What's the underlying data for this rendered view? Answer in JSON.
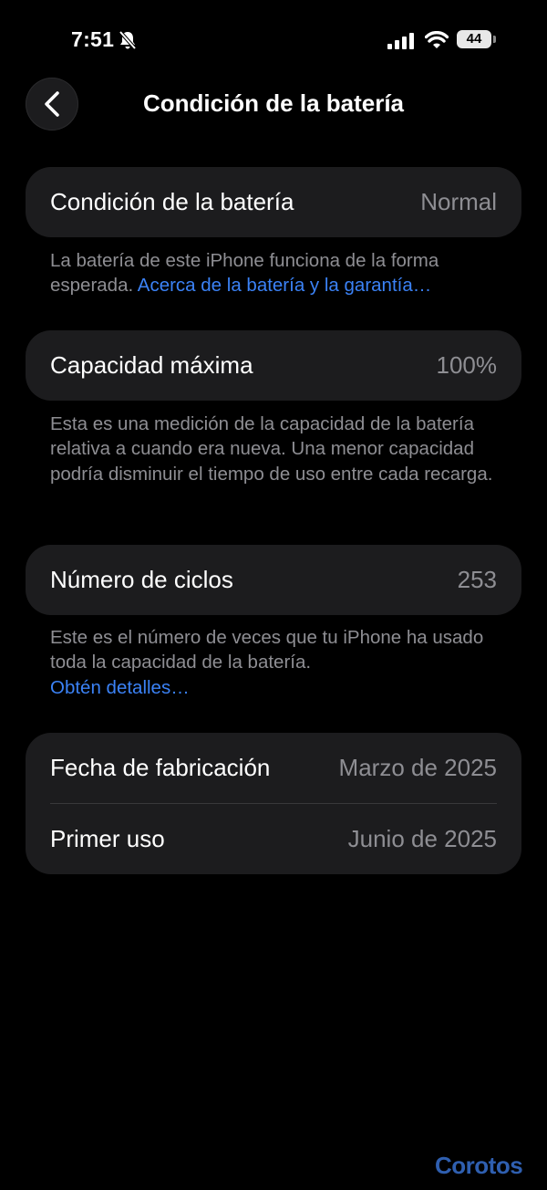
{
  "status_bar": {
    "time": "7:51",
    "battery_level": "44",
    "icons": [
      "bell-slash-icon",
      "cellular-signal-icon",
      "wifi-icon",
      "battery-icon"
    ]
  },
  "nav": {
    "back_icon": "chevron-left-icon",
    "title": "Condición de la batería"
  },
  "health": {
    "label": "Condición de la batería",
    "value": "Normal",
    "note": "La batería de este iPhone funciona de la forma esperada.",
    "link": "Acerca de la batería y la garantía…"
  },
  "capacity": {
    "label": "Capacidad máxima",
    "value": "100%",
    "note": "Esta es una medición de la capacidad de la batería relativa a cuando era nueva. Una menor capacidad podría disminuir el tiempo de uso entre cada recarga."
  },
  "cycles": {
    "label": "Número de ciclos",
    "value": "253",
    "note": "Este es el número de veces que tu iPhone ha usado toda la capacidad de la batería.",
    "link": "Obtén detalles…"
  },
  "dates": {
    "manufacture_label": "Fecha de fabricación",
    "manufacture_value": "Marzo de 2025",
    "first_use_label": "Primer uso",
    "first_use_value": "Junio de 2025"
  },
  "watermark": "Corotos",
  "colors": {
    "background": "#000000",
    "card": "#1c1c1e",
    "secondary_text": "#8e8e93",
    "link": "#3b82f6",
    "watermark": "#2f5fb0"
  }
}
